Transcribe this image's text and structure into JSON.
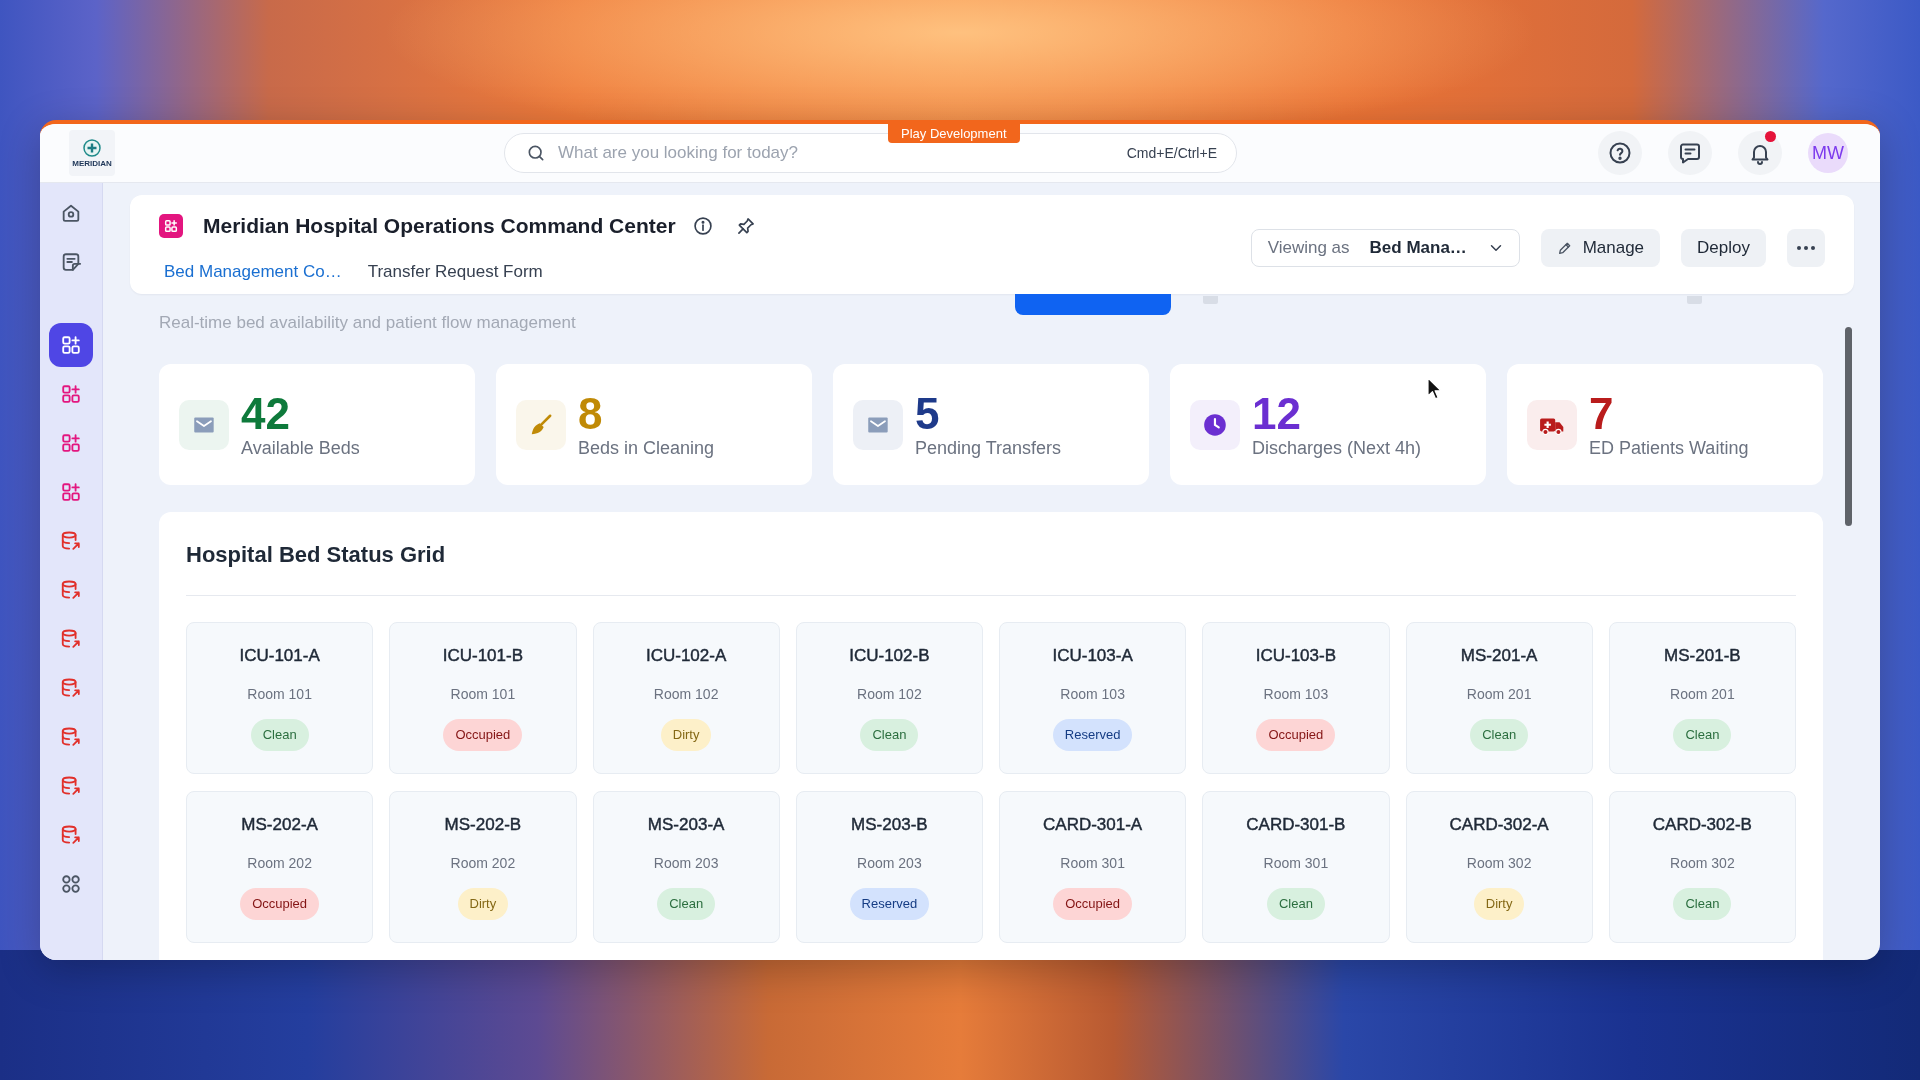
{
  "topbar": {
    "logo_text": "MERIDIAN",
    "search": {
      "placeholder": "What are you looking for today?",
      "shortcut": "Cmd+E/Ctrl+E"
    },
    "environment_tag": "Play Development",
    "notifications": {
      "unread": true
    },
    "avatar": "MW"
  },
  "sidebar": {
    "nav_items": [
      {
        "kind": "home",
        "selected": false
      },
      {
        "kind": "notes",
        "selected": false
      }
    ],
    "app_items": [
      {
        "kind": "app",
        "selected": true
      },
      {
        "kind": "app",
        "selected": false
      },
      {
        "kind": "app",
        "selected": false
      },
      {
        "kind": "app",
        "selected": false
      },
      {
        "kind": "data",
        "selected": false
      },
      {
        "kind": "data",
        "selected": false
      },
      {
        "kind": "data",
        "selected": false
      },
      {
        "kind": "data",
        "selected": false
      },
      {
        "kind": "data",
        "selected": false
      },
      {
        "kind": "data",
        "selected": false
      },
      {
        "kind": "data",
        "selected": false
      },
      {
        "kind": "more",
        "selected": false
      }
    ]
  },
  "header": {
    "title": "Meridian Hospital Operations Command Center",
    "tabs": [
      {
        "label": "Bed Management Co…",
        "selected": true
      },
      {
        "label": "Transfer Request Form",
        "selected": false
      }
    ],
    "viewing_as": {
      "label": "Viewing as",
      "value": "Bed Mana…"
    },
    "buttons": [
      {
        "label": "Manage",
        "kind": "manage"
      },
      {
        "label": "Deploy",
        "kind": "plain"
      }
    ]
  },
  "page": {
    "subtitle": "Real-time bed availability and patient flow management"
  },
  "stats": [
    {
      "value": "42",
      "label": "Available Beds",
      "kind": "available",
      "color": "#0e7a3b"
    },
    {
      "value": "8",
      "label": "Beds in Cleaning",
      "kind": "cleaning",
      "color": "#c08a06"
    },
    {
      "value": "5",
      "label": "Pending Transfers",
      "kind": "transfers",
      "color": "#1e3a8a"
    },
    {
      "value": "12",
      "label": "Discharges (Next 4h)",
      "kind": "discharges",
      "color": "#6b2fd1"
    },
    {
      "value": "7",
      "label": "ED Patients Waiting",
      "kind": "emergency",
      "color": "#b91c1c"
    }
  ],
  "bed_grid": {
    "title": "Hospital Bed Status Grid",
    "beds": [
      {
        "id": "ICU-101-A",
        "room": "Room 101",
        "status": "Clean",
        "color": "#d8f0df"
      },
      {
        "id": "ICU-101-B",
        "room": "Room 101",
        "status": "Occupied",
        "color": "#fdd5d5"
      },
      {
        "id": "ICU-102-A",
        "room": "Room 102",
        "status": "Dirty",
        "color": "#fdf0c9"
      },
      {
        "id": "ICU-102-B",
        "room": "Room 102",
        "status": "Clean",
        "color": "#d8f0df"
      },
      {
        "id": "ICU-103-A",
        "room": "Room 103",
        "status": "Reserved",
        "color": "#d3e2fd"
      },
      {
        "id": "ICU-103-B",
        "room": "Room 103",
        "status": "Occupied",
        "color": "#fdd5d5"
      },
      {
        "id": "MS-201-A",
        "room": "Room 201",
        "status": "Clean",
        "color": "#d8f0df"
      },
      {
        "id": "MS-201-B",
        "room": "Room 201",
        "status": "Clean",
        "color": "#d8f0df"
      },
      {
        "id": "MS-202-A",
        "room": "Room 202",
        "status": "Occupied",
        "color": "#fdd5d5"
      },
      {
        "id": "MS-202-B",
        "room": "Room 202",
        "status": "Dirty",
        "color": "#fdf0c9"
      },
      {
        "id": "MS-203-A",
        "room": "Room 203",
        "status": "Clean",
        "color": "#d8f0df"
      },
      {
        "id": "MS-203-B",
        "room": "Room 203",
        "status": "Reserved",
        "color": "#d3e2fd"
      },
      {
        "id": "CARD-301-A",
        "room": "Room 301",
        "status": "Occupied",
        "color": "#fdd5d5"
      },
      {
        "id": "CARD-301-B",
        "room": "Room 301",
        "status": "Clean",
        "color": "#d8f0df"
      },
      {
        "id": "CARD-302-A",
        "room": "Room 302",
        "status": "Dirty",
        "color": "#fdf0c9"
      },
      {
        "id": "CARD-302-B",
        "room": "Room 302",
        "status": "Clean",
        "color": "#d8f0df"
      }
    ]
  }
}
